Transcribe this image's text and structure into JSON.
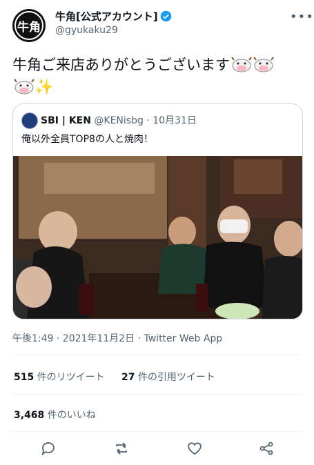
{
  "account": {
    "avatar_text": "牛角",
    "display_name": "牛角[公式アカウント]",
    "handle": "@gyukaku29",
    "verified_color": "#1d9bf0"
  },
  "tweet": {
    "text": "牛角ご来店ありがとうございます"
  },
  "quote": {
    "author_name": "SBI | KEN",
    "author_handle": "@KENisbg",
    "date": "· 10月31日",
    "text": "俺以外全員TOP8の人と焼肉！"
  },
  "meta": {
    "timestamp": "午後1:49 · 2021年11月2日 · Twitter Web App"
  },
  "stats": {
    "retweets_count": "515",
    "retweets_label": "件のリツイート",
    "quotes_count": "27",
    "quotes_label": "件の引用ツイート",
    "likes_count": "3,468",
    "likes_label": "件のいいね"
  },
  "actions": [
    "reply-icon",
    "retweet-icon",
    "like-icon",
    "share-icon"
  ]
}
